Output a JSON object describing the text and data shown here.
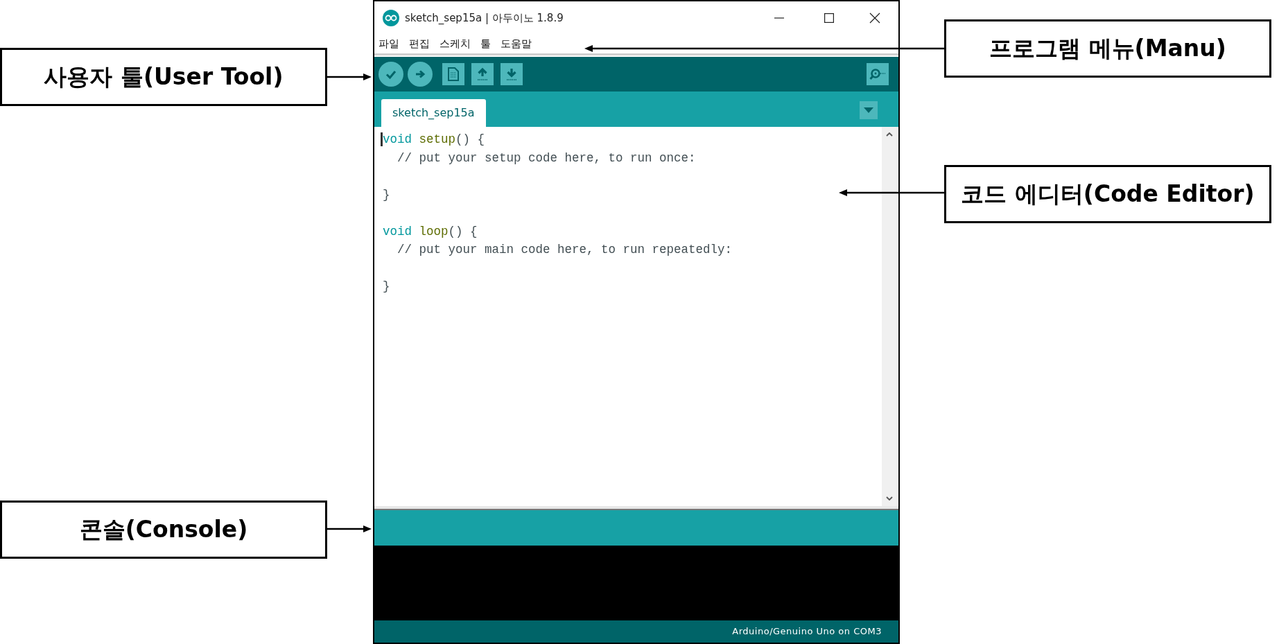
{
  "window": {
    "title": "sketch_sep15a | 아두이노 1.8.9"
  },
  "menu": [
    "파일",
    "편집",
    "스케치",
    "툴",
    "도움말"
  ],
  "tabs": [
    {
      "label": "sketch_sep15a",
      "selected": true
    }
  ],
  "editor": {
    "lines": [
      {
        "kind": "code",
        "tokens": [
          {
            "kind": "keyword",
            "text": "void"
          },
          {
            "kind": "function",
            "text": " setup"
          },
          {
            "kind": "plain",
            "text": "() {"
          }
        ]
      },
      {
        "kind": "code",
        "tokens": [
          {
            "kind": "comment",
            "text": "  // put your setup code here, to run once:"
          }
        ]
      },
      {
        "kind": "blank"
      },
      {
        "kind": "code",
        "tokens": [
          {
            "kind": "plain",
            "text": "}"
          }
        ]
      },
      {
        "kind": "blank"
      },
      {
        "kind": "code",
        "tokens": [
          {
            "kind": "keyword",
            "text": "void"
          },
          {
            "kind": "function",
            "text": " loop"
          },
          {
            "kind": "plain",
            "text": "() {"
          }
        ]
      },
      {
        "kind": "code",
        "tokens": [
          {
            "kind": "comment",
            "text": "  // put your main code here, to run repeatedly:"
          }
        ]
      },
      {
        "kind": "blank"
      },
      {
        "kind": "code",
        "tokens": [
          {
            "kind": "plain",
            "text": "}"
          }
        ]
      }
    ]
  },
  "status_bar": "Arduino/Genuino Uno on COM3",
  "annotations": [
    {
      "label": "사용자 툴(User Tool)"
    },
    {
      "label": "콘솔(Console)"
    },
    {
      "label": "프로그램 메뉴(Manu)"
    },
    {
      "label": "코드 에디터(Code Editor)"
    }
  ]
}
